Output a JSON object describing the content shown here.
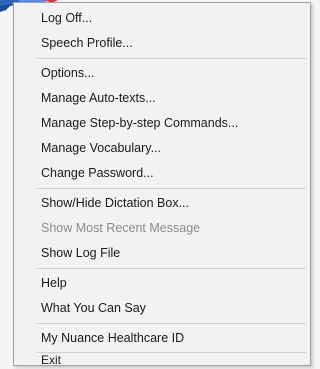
{
  "menu": {
    "items": [
      {
        "label": "Log Off..."
      },
      {
        "label": "Speech Profile..."
      },
      {
        "label": "Options..."
      },
      {
        "label": "Manage Auto-texts..."
      },
      {
        "label": "Manage Step-by-step Commands..."
      },
      {
        "label": "Manage Vocabulary..."
      },
      {
        "label": "Change Password..."
      },
      {
        "label": "Show/Hide Dictation Box..."
      },
      {
        "label": "Show Most Recent Message",
        "disabled": true
      },
      {
        "label": "Show Log File"
      },
      {
        "label": "Help"
      },
      {
        "label": "What You Can Say"
      },
      {
        "label": "My Nuance Healthcare ID"
      },
      {
        "label": "Exit"
      }
    ]
  },
  "colors": {
    "menu_background": "#f2f2f2",
    "menu_border": "#a0a0a0",
    "text": "#1a1a1a",
    "disabled_text": "#8c8c8c",
    "separator": "#cfcfcf",
    "app_icon_blue": "#2e63b8",
    "app_icon_red": "#d23a3a"
  }
}
